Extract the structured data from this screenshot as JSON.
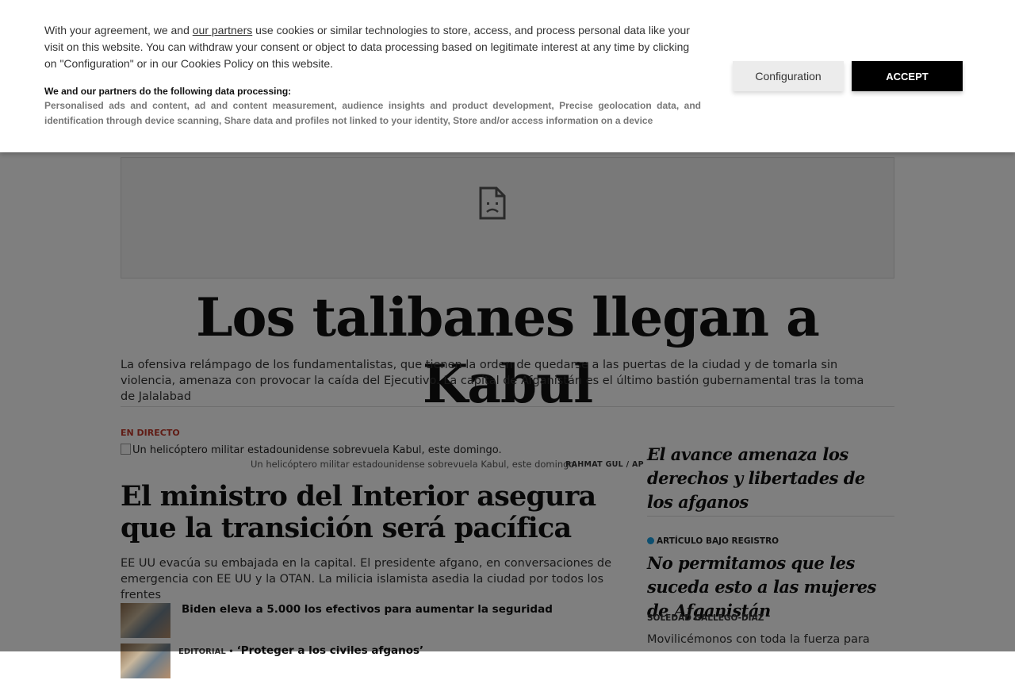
{
  "cookie_banner": {
    "text_before_link": "With your agreement, we and ",
    "partners_link": "our partners",
    "text_after_link": " use cookies or similar technologies to store, access, and process personal data like your visit on this website. You can withdraw your consent or object to data processing based on legitimate interest at any time by clicking on \"Configuration\" or in our Cookies Policy on this website.",
    "processing_title": "We and our partners do the following data processing:",
    "processing_list": "Personalised ads and content, ad and content measurement, audience insights and product development, Precise geolocation data, and identification through device scanning, Share data and profiles not linked to your identity, Store and/or access information on a device",
    "configuration_label": "Configuration",
    "accept_label": "ACCEPT"
  },
  "article": {
    "headline": "Los talibanes llegan a Kabul",
    "lead": "La ofensiva relámpago de los fundamentalistas, que tienen la orden de quedarse a las puertas de la ciudad y de tomarla sin violencia, amenaza con provocar la caída del Ejecutivo. La capital de Afganistán es el último bastión gubernamental tras la toma de Jalalabad",
    "live_label": "EN DIRECTO",
    "image_alt": "Un helicóptero militar estadounidense sobrevuela Kabul, este domingo.",
    "image_caption": "Un helicóptero militar estadounidense sobrevuela Kabul, este domingo.",
    "image_credit": "RAHMAT GUL / AP",
    "main_title": "El ministro del Interior asegura que la transición será pacífica",
    "main_lead": "EE UU evacúa su embajada en la capital. El presidente afgano, en conversaciones de emergencia con EE UU y la OTAN. La milicia islamista asedia la ciudad por todos los frentes",
    "related": [
      {
        "tag": "",
        "text": "Biden eleva a 5.000 los efectivos para aumentar la seguridad"
      },
      {
        "tag": "EDITORIAL •",
        "text": "‘Proteger a los civiles afganos’"
      }
    ]
  },
  "sidebar": {
    "story1_title": "El avance amenaza los derechos y libertades de los afganos",
    "badge": "ARTÍCULO BAJO REGISTRO",
    "badge_color": "#1a9fe0",
    "story2_title": "No permitamos que les suceda esto a las mujeres de Afganistán",
    "author": "SOLEDAD GALLEGO-DÍAZ",
    "story2_lead": "Movilicémonos con toda la fuerza para"
  }
}
